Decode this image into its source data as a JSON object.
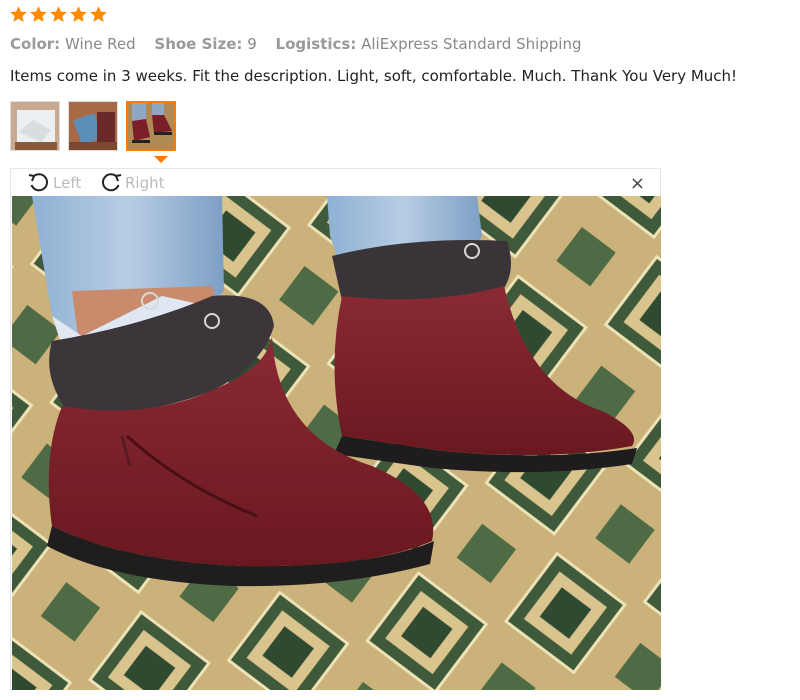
{
  "rating": {
    "stars": 5,
    "color": "#ff8a00"
  },
  "attributes": [
    {
      "key": "Color:",
      "value": "Wine Red"
    },
    {
      "key": "Shoe Size:",
      "value": "9"
    },
    {
      "key": "Logistics:",
      "value": "AliExpress Standard Shipping"
    }
  ],
  "review_text": "Items come in 3 weeks. Fit the description. Light, soft, comfortable. Much. Thank You Very Much!",
  "thumbnails": [
    {
      "icon": "package-photo-icon"
    },
    {
      "icon": "box-photo-icon"
    },
    {
      "icon": "boots-photo-icon",
      "active": true
    }
  ],
  "viewer": {
    "rotate_left_label": "Left",
    "rotate_right_label": "Right",
    "close_glyph": "×"
  },
  "colors": {
    "accent": "#ff7a00",
    "boot": "#7a1e28"
  }
}
